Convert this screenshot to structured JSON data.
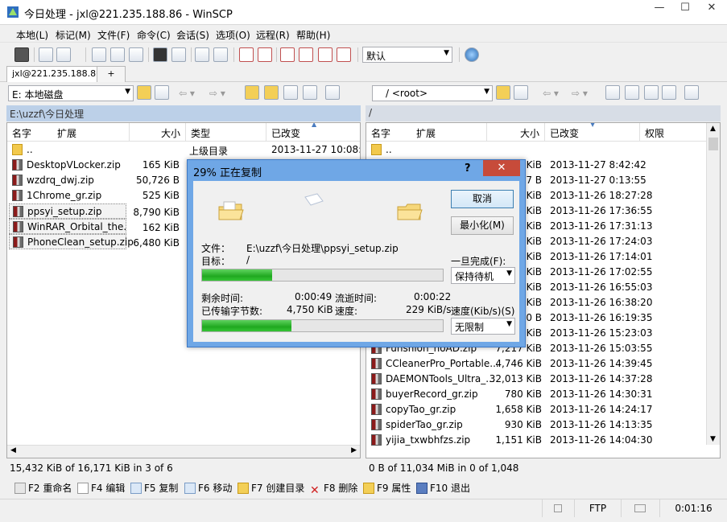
{
  "window": {
    "title": "今日处理 - jxl@221.235.188.86 - WinSCP",
    "minimize": "—",
    "maximize": "☐",
    "close": "✕"
  },
  "menu": [
    "本地(L)",
    "标记(M)",
    "文件(F)",
    "命令(C)",
    "会话(S)",
    "选项(O)",
    "远程(R)",
    "帮助(H)"
  ],
  "toolbar": {
    "transfer_profile": "默认"
  },
  "tabs": {
    "session": "jxl@221.235.188.86",
    "new": "+"
  },
  "local": {
    "drive": "E: 本地磁盘",
    "path": "E:\\uzzf\\今日处理",
    "columns": {
      "name": "名字",
      "ext": "扩展",
      "size": "大小",
      "type": "类型",
      "changed": "已改变"
    },
    "files": [
      {
        "name": "..",
        "size": "",
        "type": "上级目录",
        "changed": "2013-11-27  10:08:36"
      },
      {
        "name": "DesktopVLocker.zip",
        "size": "165 KiB"
      },
      {
        "name": "wzdrq_dwj.zip",
        "size": "50,726 B"
      },
      {
        "name": "1Chrome_gr.zip",
        "size": "525 KiB"
      },
      {
        "name": "ppsyi_setup.zip",
        "size": "8,790 KiB"
      },
      {
        "name": "WinRAR_Orbital_the...",
        "size": "162 KiB"
      },
      {
        "name": "PhoneClean_setup.zip",
        "size": "6,480 KiB"
      }
    ],
    "status": "15,432 KiB of 16,171 KiB in 3 of 6"
  },
  "remote": {
    "dir": "/ <root>",
    "path": "/",
    "columns": {
      "name": "名字",
      "ext": "扩展",
      "size": "大小",
      "changed": "已改变",
      "rights": "权限"
    },
    "files": [
      {
        "name": "..",
        "size": "",
        "changed": ""
      },
      {
        "name": "",
        "size": "KiB",
        "changed": "2013-11-27 8:42:42"
      },
      {
        "name": "",
        "size": "7 B",
        "changed": "2013-11-27 0:13:55"
      },
      {
        "name": "",
        "size": "KiB",
        "changed": "2013-11-26 18:27:28"
      },
      {
        "name": "",
        "size": "KiB",
        "changed": "2013-11-26 17:36:55"
      },
      {
        "name": "",
        "size": "KiB",
        "changed": "2013-11-26 17:31:13"
      },
      {
        "name": "",
        "size": "KiB",
        "changed": "2013-11-26 17:24:03"
      },
      {
        "name": "",
        "size": "KiB",
        "changed": "2013-11-26 17:14:01"
      },
      {
        "name": "",
        "size": "KiB",
        "changed": "2013-11-26 17:02:55"
      },
      {
        "name": "",
        "size": "KiB",
        "changed": "2013-11-26 16:55:03"
      },
      {
        "name": "",
        "size": "KiB",
        "changed": "2013-11-26 16:38:20"
      },
      {
        "name": "",
        "size": "0 B",
        "changed": "2013-11-26 16:19:35"
      },
      {
        "name": "",
        "size": "KiB",
        "changed": "2013-11-26 15:23:03"
      },
      {
        "name": "Funshion_noAD.zip",
        "size": "7,217 KiB",
        "changed": "2013-11-26 15:03:55"
      },
      {
        "name": "CCleanerPro_Portable...",
        "size": "4,746 KiB",
        "changed": "2013-11-26 14:39:45"
      },
      {
        "name": "DAEMONTools_Ultra_...",
        "size": "32,013 KiB",
        "changed": "2013-11-26 14:37:28"
      },
      {
        "name": "buyerRecord_gr.zip",
        "size": "780 KiB",
        "changed": "2013-11-26 14:30:31"
      },
      {
        "name": "copyTao_gr.zip",
        "size": "1,658 KiB",
        "changed": "2013-11-26 14:24:17"
      },
      {
        "name": "spiderTao_gr.zip",
        "size": "930 KiB",
        "changed": "2013-11-26 14:13:35"
      },
      {
        "name": "yijia_txwbhfzs.zip",
        "size": "1,151 KiB",
        "changed": "2013-11-26 14:04:30"
      }
    ],
    "status": "0 B of 11,034 MiB in 0 of 1,048"
  },
  "fkeys": [
    "F2 重命名",
    "F4 编辑",
    "F5 复制",
    "F6 移动",
    "F7 创建目录",
    "F8 删除",
    "F9 属性",
    "F10 退出"
  ],
  "statusbar": {
    "protocol": "FTP",
    "elapsed": "0:01:16"
  },
  "dialog": {
    "title": "29% 正在复制",
    "help": "?",
    "close": "✕",
    "cancel": "取消",
    "minimize": "最小化(M)",
    "file_label": "文件：",
    "file_value": "E:\\uzzf\\今日处理\\ppsyi_setup.zip",
    "target_label": "目标：",
    "target_value": "/",
    "file_progress": 0.29,
    "once_done_label": "一旦完成(F):",
    "once_done_value": "保持待机",
    "remaining_label": "剩余时间:",
    "remaining_value": "0:00:49",
    "elapsed_label": "流逝时间:",
    "elapsed_value": "0:00:22",
    "transferred_label": "已传输字节数:",
    "transferred_value": "4,750 KiB",
    "speed_label": "速度:",
    "speed_value": "229 KiB/s",
    "speed_limit_label": "速度(Kib/s)(S)",
    "speed_limit_value": "无限制",
    "total_progress": 0.37
  }
}
